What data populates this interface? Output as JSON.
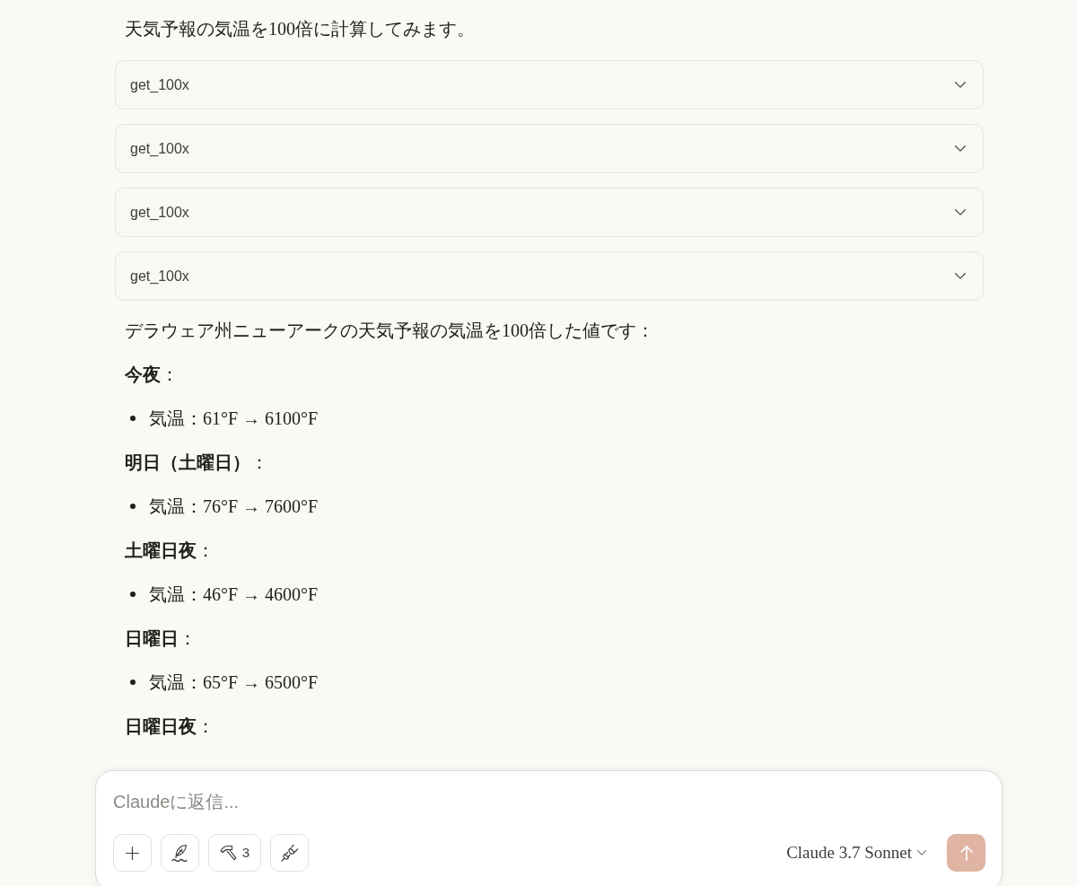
{
  "response": {
    "intro": "天気予報の気温を100倍に計算してみます。",
    "tool_calls": [
      {
        "name": "get_100x",
        "expanded": false
      },
      {
        "name": "get_100x",
        "expanded": false
      },
      {
        "name": "get_100x",
        "expanded": false
      },
      {
        "name": "get_100x",
        "expanded": false
      }
    ],
    "summary": "デラウェア州ニューアークの天気予報の気温を100倍した値です：",
    "sections": [
      {
        "heading": "**今夜**：",
        "items": [
          "気温：61°F → 6100°F"
        ]
      },
      {
        "heading": "**明日（土曜日）**：",
        "items": [
          "気温：76°F → 7600°F"
        ]
      },
      {
        "heading": "**土曜日夜**：",
        "items": [
          "気温：46°F → 4600°F"
        ]
      },
      {
        "heading": "**日曜日**：",
        "items": [
          "気温：65°F → 6500°F"
        ]
      },
      {
        "heading": "**日曜日夜**："
      }
    ]
  },
  "composer": {
    "placeholder": "Claudeに返信...",
    "tools_count": "3",
    "model": "Claude 3.7 Sonnet",
    "send_disabled": true
  }
}
